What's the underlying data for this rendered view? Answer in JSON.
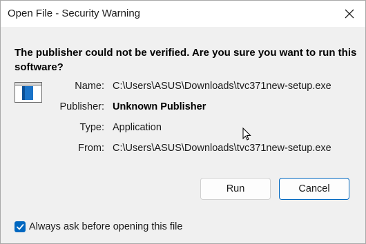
{
  "window": {
    "title": "Open File - Security Warning"
  },
  "dialog": {
    "question": "The publisher could not be verified.  Are you sure you want to run this software?",
    "details": [
      {
        "label": "Name:",
        "value": "C:\\Users\\ASUS\\Downloads\\tvc371new-setup.exe",
        "bold": false
      },
      {
        "label": "Publisher:",
        "value": "Unknown Publisher",
        "bold": true
      },
      {
        "label": "Type:",
        "value": "Application",
        "bold": false
      },
      {
        "label": "From:",
        "value": "C:\\Users\\ASUS\\Downloads\\tvc371new-setup.exe",
        "bold": false
      }
    ]
  },
  "buttons": {
    "run_label": "Run",
    "cancel_label": "Cancel"
  },
  "checkbox": {
    "label": "Always ask before opening this file",
    "checked": true
  },
  "icons": {
    "close": "close-icon",
    "app": "application-window-icon",
    "checkmark": "checkmark-icon",
    "cursor": "mouse-pointer-icon"
  },
  "colors": {
    "accent": "#0067c0",
    "titlebar": "#ffffff",
    "background": "#f0f0f0"
  }
}
